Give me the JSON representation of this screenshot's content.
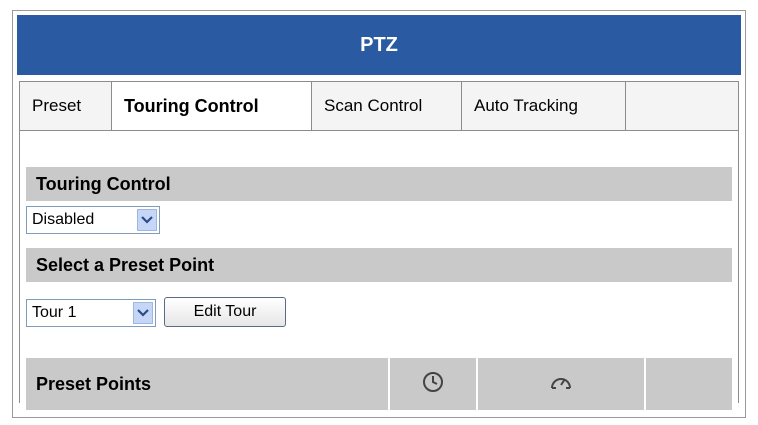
{
  "header": {
    "title": "PTZ"
  },
  "tabs": [
    {
      "label": "Preset",
      "active": false
    },
    {
      "label": "Touring Control",
      "active": true
    },
    {
      "label": "Scan Control",
      "active": false
    },
    {
      "label": "Auto Tracking",
      "active": false
    }
  ],
  "touring_section": {
    "title": "Touring Control",
    "select_value": "Disabled"
  },
  "preset_section": {
    "title": "Select a Preset Point",
    "tour_select_value": "Tour 1",
    "edit_button_label": "Edit Tour"
  },
  "table": {
    "header_label": "Preset Points",
    "columns": [
      "clock-icon",
      "speed-gauge-icon",
      ""
    ]
  },
  "colors": {
    "header_bg": "#2a5aa1",
    "section_bg": "#c9c9c9"
  }
}
